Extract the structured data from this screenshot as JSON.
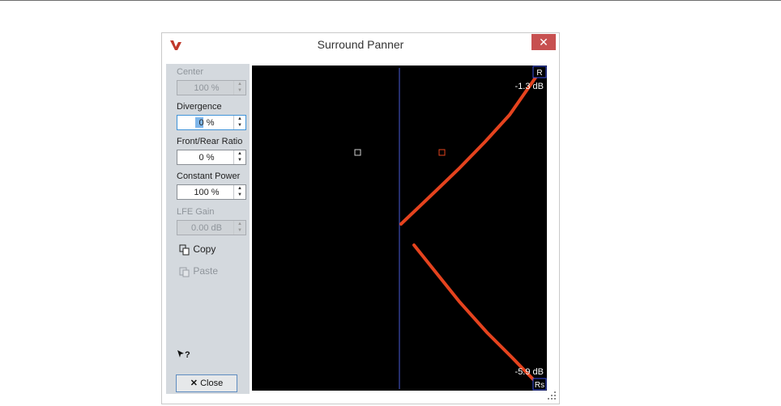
{
  "window": {
    "title": "Surround Panner",
    "close_glyph": "✕"
  },
  "controls": {
    "center": {
      "label": "Center",
      "value": "100 %",
      "enabled": false
    },
    "divergence": {
      "label": "Divergence",
      "value_selected": "0",
      "value_suffix": " %",
      "enabled": true
    },
    "front_rear": {
      "label": "Front/Rear Ratio",
      "value": "0 %",
      "enabled": true
    },
    "constant_power": {
      "label": "Constant Power",
      "value": "100 %",
      "enabled": true
    },
    "lfe_gain": {
      "label": "LFE Gain",
      "value": "0.00 dB",
      "enabled": false
    }
  },
  "actions": {
    "copy_label": "Copy",
    "paste_label": "Paste",
    "close_label": "Close",
    "help_glyph": "?"
  },
  "panner": {
    "top_speaker": "R",
    "bottom_speaker": "Rs",
    "top_level": "-1.3 dB",
    "bottom_level": "-5.9 dB",
    "line_color": "#e5431e",
    "divider_color": "#4a5bd4"
  },
  "icons": [
    "app-logo-icon",
    "close-icon",
    "copy-icon",
    "paste-icon",
    "help-cursor-icon",
    "resize-grip-icon"
  ]
}
